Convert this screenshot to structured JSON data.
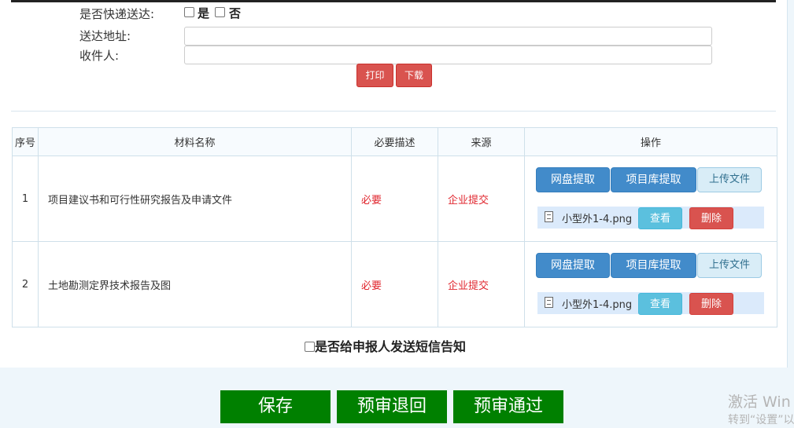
{
  "form": {
    "express_label": "是否快递送达:",
    "yes_label": "是",
    "no_label": "否",
    "address_label": "送达地址:",
    "address_value": "",
    "recipient_label": "收件人:",
    "recipient_value": "",
    "print_button": "打印",
    "download_button": "下载"
  },
  "table": {
    "headers": [
      "序号",
      "材料名称",
      "必要描述",
      "来源",
      "操作"
    ],
    "rows": [
      {
        "no": "1",
        "name": "项目建议书和可行性研究报告及申请文件",
        "required": "必要",
        "source": "企业提交",
        "file": "小型外1-4.png"
      },
      {
        "no": "2",
        "name": "土地勘测定界技术报告及图",
        "required": "必要",
        "source": "企业提交",
        "file": "小型外1-4.png"
      }
    ],
    "actions": {
      "netdisk": "网盘提取",
      "library": "项目库提取",
      "upload": "上传文件",
      "view": "查看",
      "delete": "删除"
    }
  },
  "sms_label": "是否给申报人发送短信告知",
  "footer": {
    "save": "保存",
    "return": "预审退回",
    "pass": "预审通过"
  },
  "watermark": {
    "line1": "激活 Win",
    "line2": "转到“设置”以"
  },
  "colors": {
    "primary_blue": "#428bca",
    "danger_red": "#d9534f",
    "info_cyan": "#5bc0de",
    "green": "#008000",
    "required_red": "#e0262e"
  }
}
